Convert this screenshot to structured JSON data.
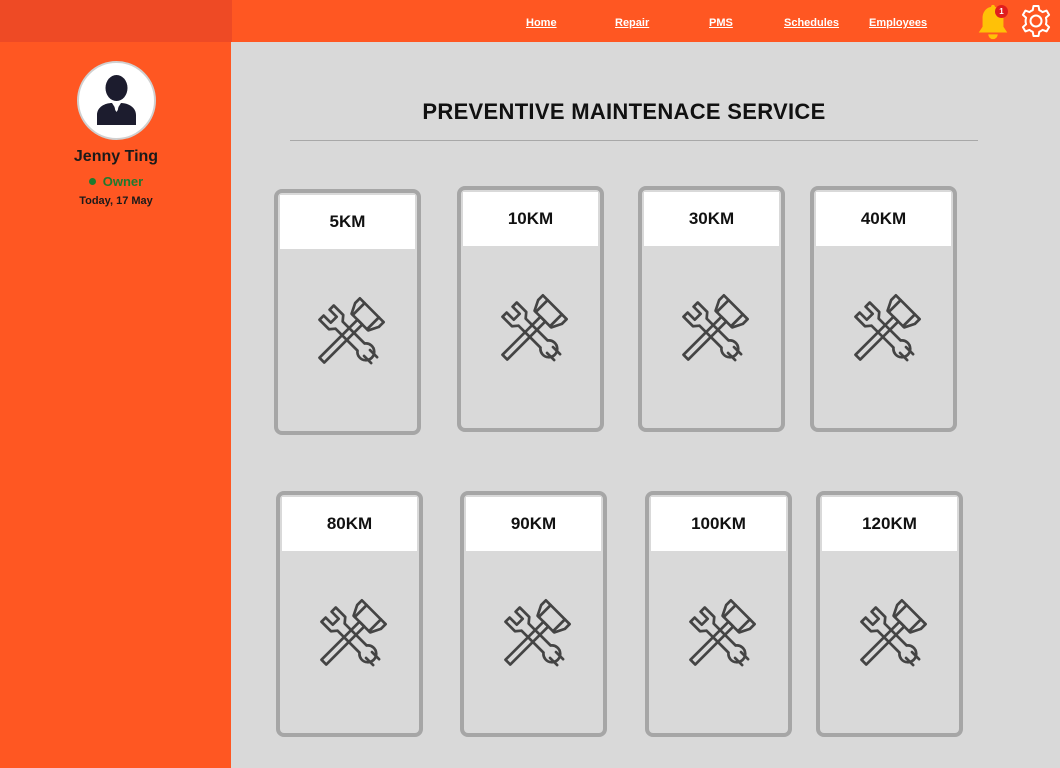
{
  "nav": {
    "items": [
      {
        "label": "Home"
      },
      {
        "label": "Repair"
      },
      {
        "label": "PMS"
      },
      {
        "label": "Schedules"
      },
      {
        "label": "Employees"
      }
    ],
    "notification_count": "1",
    "icons": {
      "notifications": "bell-icon",
      "settings": "gear-icon"
    }
  },
  "user": {
    "name": "Jenny Ting",
    "role": "Owner",
    "date": "Today, 17 May"
  },
  "main": {
    "title": "PREVENTIVE MAINTENACE SERVICE",
    "cards": [
      {
        "label": "5KM",
        "icon": "tools-icon"
      },
      {
        "label": "10KM",
        "icon": "tools-icon"
      },
      {
        "label": "30KM",
        "icon": "tools-icon"
      },
      {
        "label": "40KM",
        "icon": "tools-icon"
      },
      {
        "label": "80KM",
        "icon": "tools-icon"
      },
      {
        "label": "90KM",
        "icon": "tools-icon"
      },
      {
        "label": "100KM",
        "icon": "tools-icon"
      },
      {
        "label": "120KM",
        "icon": "tools-icon"
      }
    ]
  },
  "colors": {
    "accent": "#ff5722",
    "corner": "#ee4a25",
    "content_bg": "#d9d9d9",
    "bell": "#ffc107",
    "badge": "#e01e1e",
    "status_online": "#1f7a2e"
  }
}
